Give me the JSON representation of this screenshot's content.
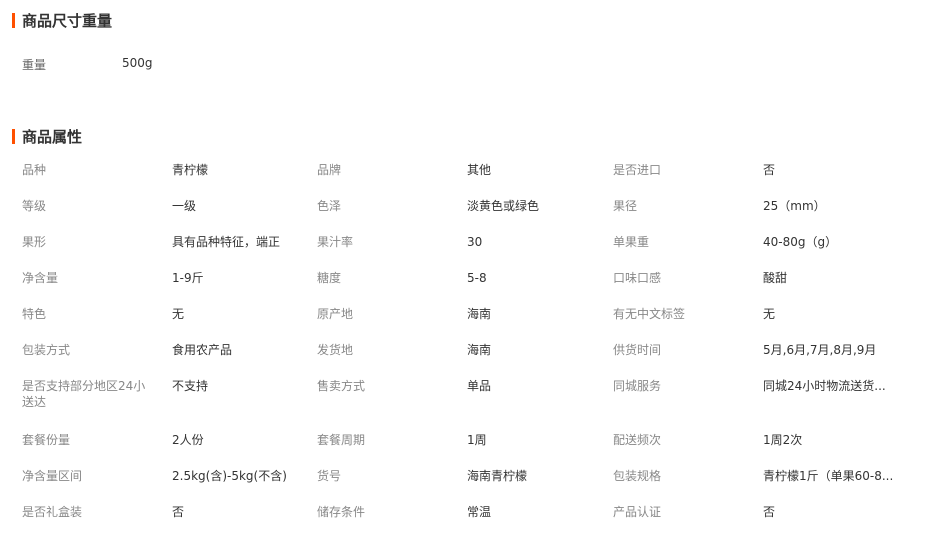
{
  "size_section": {
    "title": "商品尺寸重量",
    "weight_label": "重量",
    "weight_value": "500g"
  },
  "attrs_section": {
    "title": "商品属性",
    "rows": [
      [
        [
          "品种",
          "青柠檬"
        ],
        [
          "品牌",
          "其他"
        ],
        [
          "是否进口",
          "否"
        ]
      ],
      [
        [
          "等级",
          "一级"
        ],
        [
          "色泽",
          "淡黄色或绿色"
        ],
        [
          "果径",
          "25（mm）"
        ]
      ],
      [
        [
          "果形",
          "具有品种特征，端正"
        ],
        [
          "果汁率",
          "30"
        ],
        [
          "单果重",
          "40-80g（g）"
        ]
      ],
      [
        [
          "净含量",
          "1-9斤"
        ],
        [
          "糖度",
          "5-8"
        ],
        [
          "口味口感",
          "酸甜"
        ]
      ],
      [
        [
          "特色",
          "无"
        ],
        [
          "原产地",
          "海南"
        ],
        [
          "有无中文标签",
          "无"
        ]
      ],
      [
        [
          "包装方式",
          "食用农产品"
        ],
        [
          "发货地",
          "海南"
        ],
        [
          "供货时间",
          "5月,6月,7月,8月,9月"
        ]
      ],
      [
        [
          "是否支持部分地区24小送达",
          "不支持"
        ],
        [
          "售卖方式",
          "单品"
        ],
        [
          "同城服务",
          "同城24小时物流送货..."
        ]
      ],
      [
        [
          "套餐份量",
          "2人份"
        ],
        [
          "套餐周期",
          "1周"
        ],
        [
          "配送频次",
          "1周2次"
        ]
      ],
      [
        [
          "净含量区间",
          "2.5kg(含)-5kg(不含)"
        ],
        [
          "货号",
          "海南青柠檬"
        ],
        [
          "包装规格",
          "青柠檬1斤（单果60-8..."
        ]
      ],
      [
        [
          "是否礼盒装",
          "否"
        ],
        [
          "储存条件",
          "常温"
        ],
        [
          "产品认证",
          "否"
        ]
      ]
    ]
  },
  "colors": {
    "accent": "#ff5000",
    "label": "#888888",
    "value": "#333333"
  }
}
